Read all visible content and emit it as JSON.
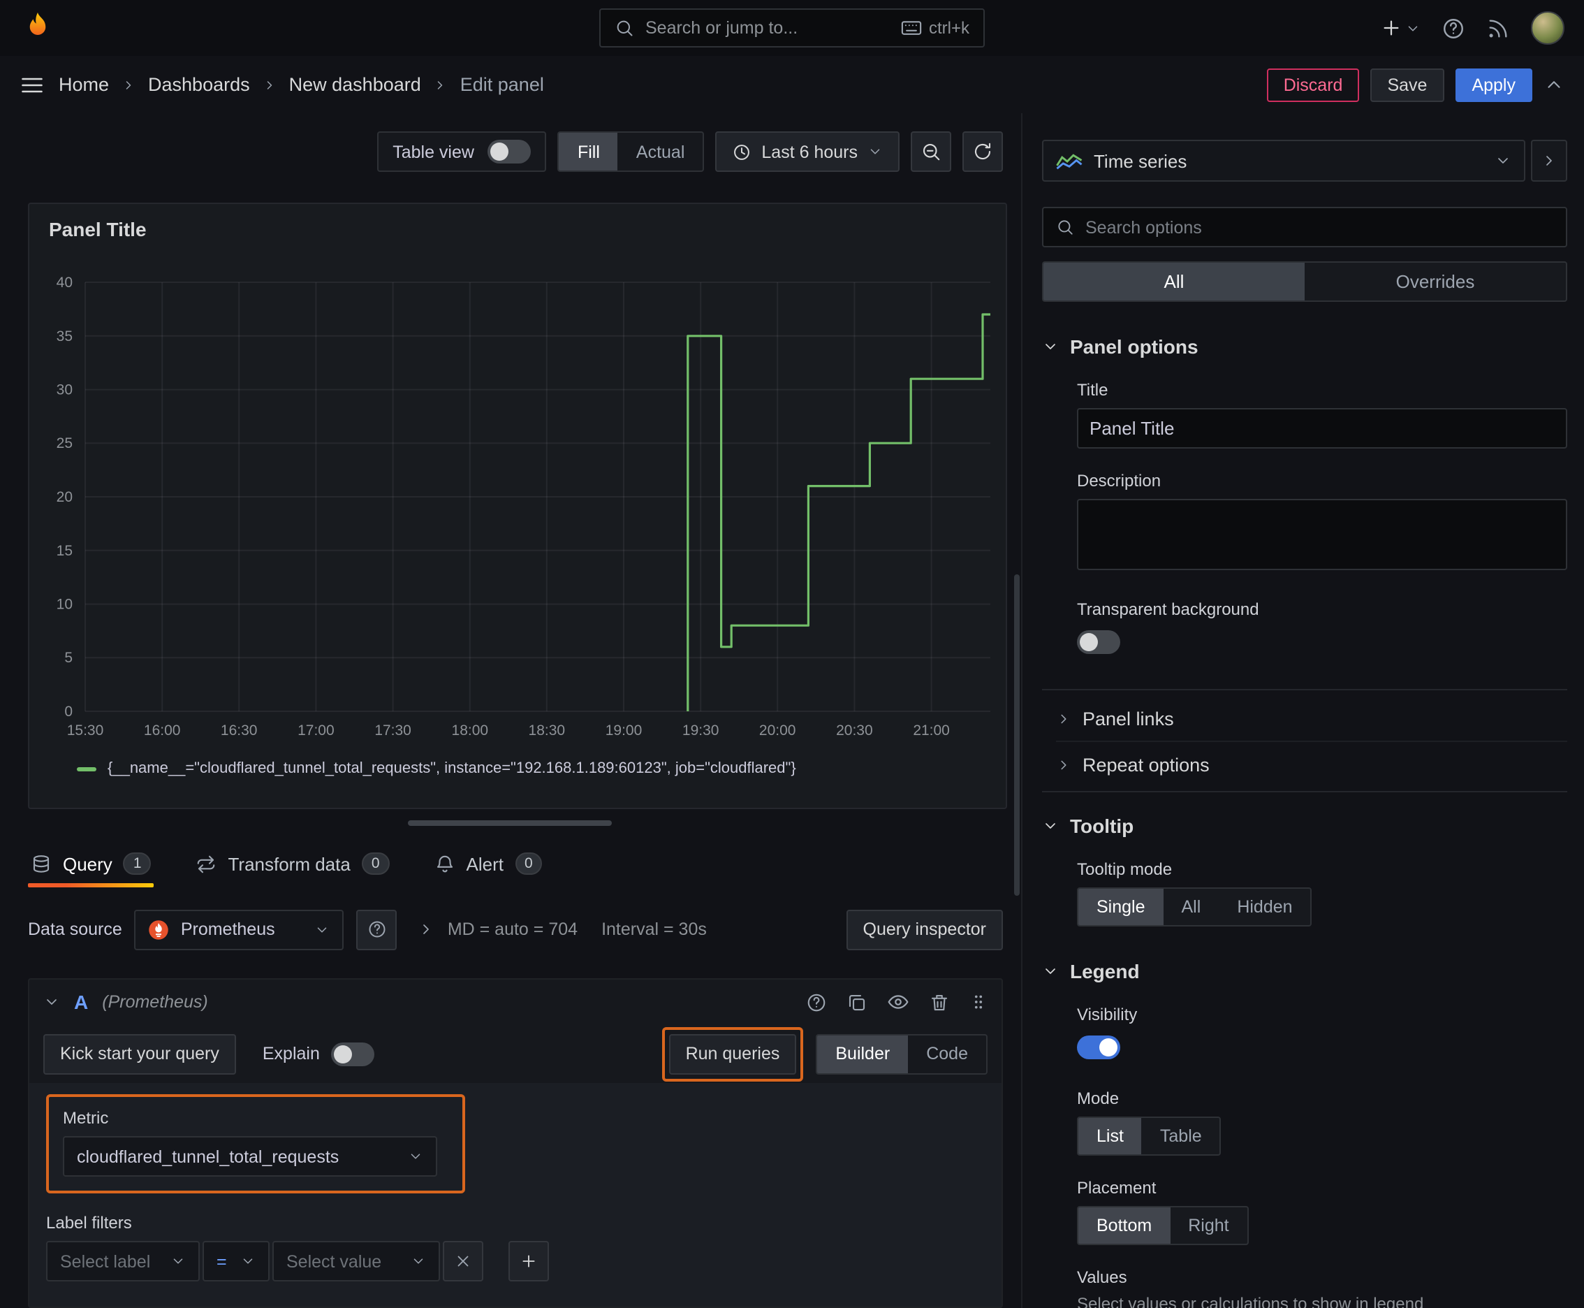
{
  "colors": {
    "accent_blue": "#3d71d9",
    "highlight_orange": "#d9661e",
    "series_green": "#73bf69",
    "discard_red": "#cf2f5f",
    "tab_underline_orange": "#f05a28"
  },
  "topbar": {
    "search_placeholder": "Search or jump to...",
    "shortcut": "ctrl+k"
  },
  "breadcrumb": {
    "items": [
      "Home",
      "Dashboards",
      "New dashboard",
      "Edit panel"
    ]
  },
  "actions": {
    "discard": "Discard",
    "save": "Save",
    "apply": "Apply"
  },
  "toolbar": {
    "table_view": "Table view",
    "fill": "Fill",
    "actual": "Actual",
    "time_range": "Last 6 hours"
  },
  "panel": {
    "title": "Panel Title"
  },
  "chart_data": {
    "type": "line",
    "line_style": "stepped",
    "title": "Panel Title",
    "grid": true,
    "legend_position": "bottom",
    "x_axis": {
      "unit": "time",
      "ticks": [
        "15:30",
        "16:00",
        "16:30",
        "17:00",
        "17:30",
        "18:00",
        "18:30",
        "19:00",
        "19:30",
        "20:00",
        "20:30",
        "21:00"
      ],
      "tick_minutes": [
        0,
        30,
        60,
        90,
        120,
        150,
        180,
        210,
        240,
        270,
        300,
        330
      ],
      "range_minutes": [
        0,
        353
      ]
    },
    "y_axis": {
      "ticks": [
        0,
        5,
        10,
        15,
        20,
        25,
        30,
        35,
        40
      ],
      "range": [
        0,
        40
      ]
    },
    "series": [
      {
        "name": "{__name__=\"cloudflared_tunnel_total_requests\", instance=\"192.168.1.189:60123\", job=\"cloudflared\"}",
        "color": "#73bf69",
        "points": [
          [
            235,
            0
          ],
          [
            235,
            35
          ],
          [
            248,
            35
          ],
          [
            248,
            6
          ],
          [
            252,
            6
          ],
          [
            252,
            8
          ],
          [
            282,
            8
          ],
          [
            282,
            21
          ],
          [
            306,
            21
          ],
          [
            306,
            25
          ],
          [
            322,
            25
          ],
          [
            322,
            31
          ],
          [
            350,
            31
          ],
          [
            350,
            37
          ],
          [
            353,
            37
          ]
        ]
      }
    ]
  },
  "tabs": {
    "query": "Query",
    "query_count": "1",
    "transform": "Transform data",
    "transform_count": "0",
    "alert": "Alert",
    "alert_count": "0"
  },
  "query": {
    "datasource_label": "Data source",
    "datasource": "Prometheus",
    "max_data_points": "MD = auto = 704",
    "interval": "Interval = 30s",
    "inspector": "Query inspector",
    "ref": "A",
    "ref_note": "(Prometheus)",
    "kick_start": "Kick start your query",
    "explain": "Explain",
    "run_queries": "Run queries",
    "builder": "Builder",
    "code": "Code",
    "metric_label": "Metric",
    "metric": "cloudflared_tunnel_total_requests",
    "label_filters": "Label filters",
    "select_label": "Select label",
    "operator": "=",
    "select_value": "Select value"
  },
  "options": {
    "viz": "Time series",
    "search_placeholder": "Search options",
    "tab_all": "All",
    "tab_overrides": "Overrides",
    "panel_options": "Panel options",
    "title_label": "Title",
    "title_value": "Panel Title",
    "description_label": "Description",
    "transparent": "Transparent background",
    "panel_links": "Panel links",
    "repeat_options": "Repeat options",
    "tooltip": "Tooltip",
    "tooltip_mode": "Tooltip mode",
    "tooltip_options": [
      "Single",
      "All",
      "Hidden"
    ],
    "legend": "Legend",
    "visibility": "Visibility",
    "mode": "Mode",
    "mode_options": [
      "List",
      "Table"
    ],
    "placement": "Placement",
    "placement_options": [
      "Bottom",
      "Right"
    ],
    "values_label": "Values",
    "values_desc": "Select values or calculations to show in legend"
  }
}
